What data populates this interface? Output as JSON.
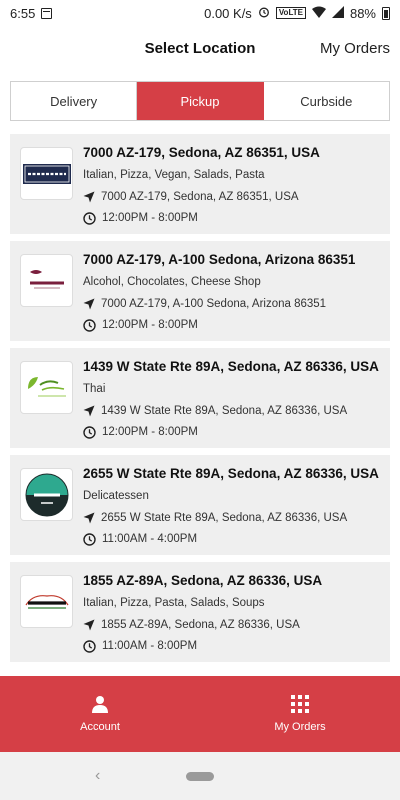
{
  "status": {
    "time": "6:55",
    "network": "0.00 K/s",
    "volte": "VoLTE",
    "battery": "88%"
  },
  "header": {
    "title": "Select Location",
    "my_orders": "My Orders"
  },
  "tabs": [
    "Delivery",
    "Pickup",
    "Curbside"
  ],
  "locations": [
    {
      "title": "7000 AZ-179, Sedona, AZ 86351, USA",
      "categories": "Italian, Pizza, Vegan, Salads, Pasta",
      "address": "7000 AZ-179, Sedona, AZ 86351, USA",
      "hours": "12:00PM - 8:00PM",
      "logo": "CORNERTABLE"
    },
    {
      "title": "7000 AZ-179, A-100 Sedona, Arizona 86351",
      "categories": "Alcohol, Chocolates, Cheese Shop",
      "address": "7000 AZ-179, A-100 Sedona, Arizona 86351",
      "hours": "12:00PM - 8:00PM",
      "logo": "Decanter"
    },
    {
      "title": "1439 W State Rte 89A, Sedona, AZ 86336, USA",
      "categories": "Thai",
      "address": "1439 W State Rte 89A, Sedona, AZ 86336, USA",
      "hours": "12:00PM - 8:00PM",
      "logo": "Fresh & Natural"
    },
    {
      "title": "2655 W State Rte 89A, Sedona, AZ 86336, USA",
      "categories": "Delicatessen",
      "address": "2655 W State Rte 89A, Sedona, AZ 86336, USA",
      "hours": "11:00AM - 4:00PM",
      "logo": "Hilltop DELI"
    },
    {
      "title": "1855 AZ-89A, Sedona, AZ 86336, USA",
      "categories": "Italian, Pizza, Pasta, Salads, Soups",
      "address": "1855 AZ-89A, Sedona, AZ 86336, USA",
      "hours": "11:00AM - 8:00PM",
      "logo": "Picazzo's"
    }
  ],
  "bottom_nav": {
    "account": "Account",
    "my_orders": "My Orders"
  },
  "colors": {
    "accent": "#d53f46"
  }
}
